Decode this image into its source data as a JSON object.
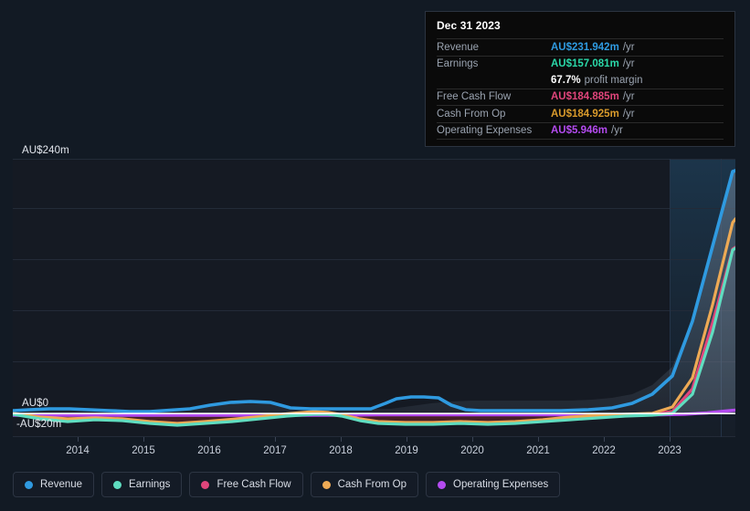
{
  "currency": "AU$",
  "colors": {
    "revenue": "#2f9ae0",
    "earnings": "#5fddc0",
    "free_cash_flow": "#e0457b",
    "cash_from_op": "#eeaa55",
    "operating_expenses": "#b44bf0",
    "zero_line": "#ffffff",
    "grid": "#232b38",
    "plot_bg": "#151a23",
    "page_bg": "#121a24",
    "tooltip_bg": "#0a0a0a"
  },
  "tooltip": {
    "date": "Dec 31 2023",
    "rows": [
      {
        "key": "Revenue",
        "value": "AU$231.942m",
        "unit": "/yr",
        "color": "#2f9ae0"
      },
      {
        "key": "Earnings",
        "value": "AU$157.081m",
        "unit": "/yr",
        "color": "#2ad8a8"
      },
      {
        "key": "Free Cash Flow",
        "value": "AU$184.885m",
        "unit": "/yr",
        "color": "#e0457b"
      },
      {
        "key": "Cash From Op",
        "value": "AU$184.925m",
        "unit": "/yr",
        "color": "#d99a2b"
      },
      {
        "key": "Operating Expenses",
        "value": "AU$5.946m",
        "unit": "/yr",
        "color": "#b44bf0"
      }
    ],
    "profit_margin": {
      "value": "67.7%",
      "label": "profit margin"
    }
  },
  "axes": {
    "y_top_label": "AU$240m",
    "y_zero_label": "AU$0",
    "y_bottom_label": "-AU$20m",
    "x_ticks": [
      "2014",
      "2015",
      "2016",
      "2017",
      "2018",
      "2019",
      "2020",
      "2021",
      "2022",
      "2023"
    ]
  },
  "legend": {
    "items": [
      {
        "label": "Revenue",
        "color": "#2f9ae0"
      },
      {
        "label": "Earnings",
        "color": "#5fddc0"
      },
      {
        "label": "Free Cash Flow",
        "color": "#e0457b"
      },
      {
        "label": "Cash From Op",
        "color": "#eeaa55"
      },
      {
        "label": "Operating Expenses",
        "color": "#b44bf0"
      }
    ]
  },
  "chart_data": {
    "type": "line",
    "title": "",
    "xlabel": "",
    "ylabel": "AU$",
    "ylim": [
      -20,
      240
    ],
    "grid": true,
    "legend_position": "bottom",
    "x": [
      2013.6,
      2014,
      2014.5,
      2015,
      2015.5,
      2016,
      2016.5,
      2017,
      2017.5,
      2018,
      2018.5,
      2019,
      2019.3,
      2019.6,
      2020,
      2020.5,
      2021,
      2021.5,
      2022,
      2022.5,
      2023,
      2023.5,
      2023.95
    ],
    "series": [
      {
        "name": "Revenue",
        "color": "#2f9ae0",
        "values": [
          2.0,
          2.5,
          3.0,
          3.0,
          2.5,
          2.0,
          1.2,
          1.5,
          2.5,
          3.5,
          7.0,
          10.5,
          10.8,
          10.5,
          4.0,
          3.0,
          3.0,
          3.2,
          3.5,
          8.0,
          30.0,
          110.0,
          231.942
        ]
      },
      {
        "name": "Earnings",
        "color": "#5fddc0",
        "values": [
          -3.0,
          -6.0,
          -7.5,
          -6.0,
          -6.5,
          -8.5,
          -10.5,
          -9.0,
          -7.0,
          -4.5,
          -2.0,
          -1.0,
          -1.0,
          -2.5,
          -6.5,
          -7.5,
          -7.5,
          -7.0,
          -7.5,
          -6.0,
          -3.0,
          60.0,
          157.081
        ]
      },
      {
        "name": "Free Cash Flow",
        "color": "#e0457b",
        "values": [
          -2.5,
          -5.0,
          -6.5,
          -5.5,
          -6.0,
          -8.0,
          -10.0,
          -8.5,
          -6.5,
          -4.0,
          -1.5,
          0.5,
          0.8,
          -1.0,
          -6.0,
          -7.0,
          -7.0,
          -6.5,
          -7.0,
          -5.5,
          -2.0,
          70.0,
          184.885
        ]
      },
      {
        "name": "Cash From Op",
        "color": "#eeaa55",
        "values": [
          -2.5,
          -5.0,
          -6.5,
          -5.5,
          -6.0,
          -8.0,
          -10.0,
          -8.5,
          -6.5,
          -4.0,
          -1.0,
          1.0,
          1.2,
          -0.8,
          -6.0,
          -7.0,
          -7.0,
          -6.5,
          -7.0,
          -5.5,
          -2.0,
          72.0,
          184.925
        ]
      },
      {
        "name": "Operating Expenses",
        "color": "#b44bf0",
        "values": [
          -1.0,
          -1.0,
          -1.0,
          -1.0,
          -1.0,
          -1.2,
          -1.2,
          -1.2,
          -1.2,
          -1.2,
          -1.2,
          -1.2,
          -1.2,
          -1.2,
          -1.2,
          -1.2,
          -1.2,
          -1.2,
          -1.2,
          -1.2,
          -1.5,
          -3.0,
          -5.946
        ]
      }
    ]
  }
}
